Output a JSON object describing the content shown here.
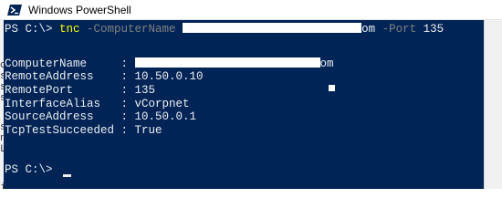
{
  "window": {
    "title": "Windows PowerShell"
  },
  "console": {
    "command": {
      "prompt": "PS C:\\> ",
      "cmdlet": "tnc",
      "param1": " -ComputerName ",
      "host_suffix": "om",
      "param2": " -Port ",
      "port_arg": "135"
    },
    "output": [
      {
        "label": "ComputerName     ",
        "sep": ": ",
        "value": "",
        "suffix": "om",
        "redacted": true
      },
      {
        "label": "RemoteAddress    ",
        "sep": ": ",
        "value": "10.50.0.10"
      },
      {
        "label": "RemotePort       ",
        "sep": ": ",
        "value": "135"
      },
      {
        "label": "InterfaceAlias   ",
        "sep": ": ",
        "value": "vCorpnet"
      },
      {
        "label": "SourceAddress    ",
        "sep": ": ",
        "value": "10.50.0.1"
      },
      {
        "label": "TcpTestSucceeded ",
        "sep": ": ",
        "value": "True"
      }
    ],
    "final_prompt": "PS C:\\> "
  },
  "background_glyphs": [
    "c",
    "s",
    "s",
    "s",
    "s",
    "n",
    "L",
    "i"
  ],
  "colors": {
    "console_bg": "#012456",
    "console_fg": "#eeedf0",
    "cmdlet": "#ffff00",
    "parameter": "#808080"
  }
}
